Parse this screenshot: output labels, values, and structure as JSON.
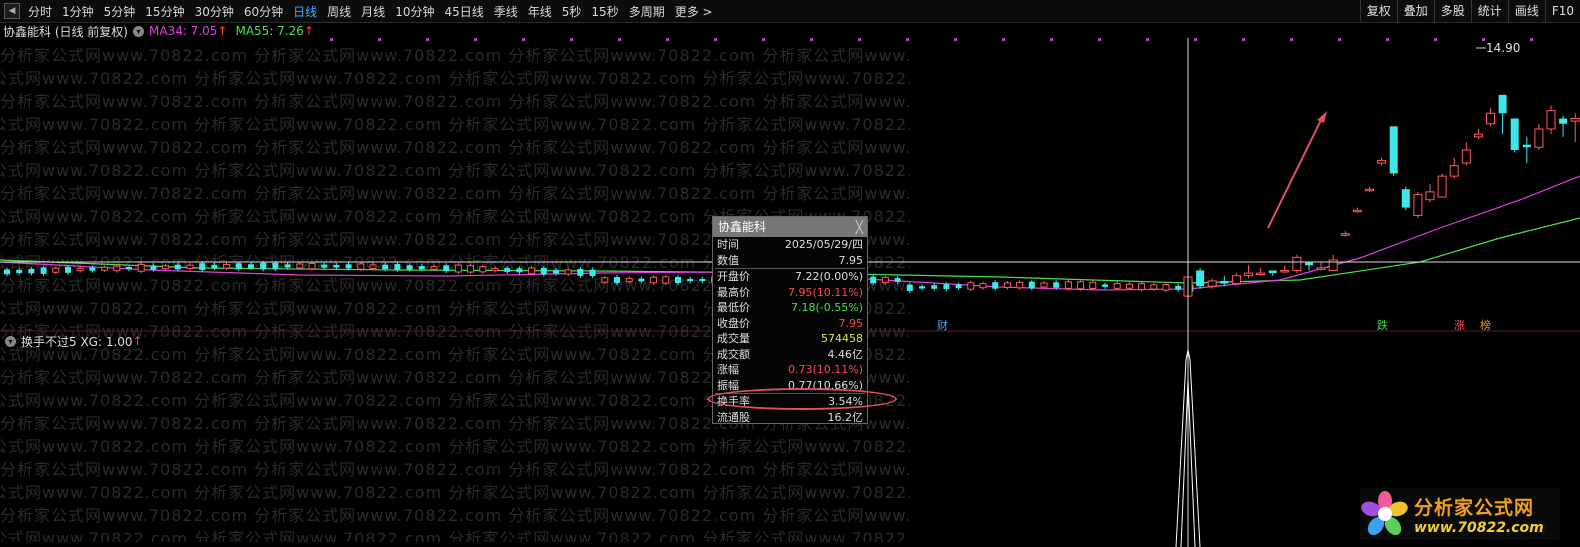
{
  "toolbar": {
    "periods": [
      "分时",
      "1分钟",
      "5分钟",
      "15分钟",
      "30分钟",
      "60分钟",
      "日线",
      "周线",
      "月线",
      "10分钟",
      "45日线",
      "季线",
      "年线",
      "5秒",
      "15秒",
      "多周期",
      "更多 >"
    ],
    "active_period": "日线",
    "right_buttons": [
      "复权",
      "叠加",
      "多股",
      "统计",
      "画线",
      "F10"
    ]
  },
  "header": {
    "stock_title": "协鑫能科 (日线 前复权)",
    "ma34_label": "MA34: 7.05",
    "ma55_label": "MA55: 7.26",
    "up_arrow": "↑"
  },
  "indicator": {
    "label": "换手不过5 XG: 1.00",
    "up_arrow": "↑"
  },
  "price_high_label": "14.90",
  "events": {
    "cai": "财",
    "die": "跌",
    "zhang": "涨",
    "bang": "榜"
  },
  "watermark": "分析家公式网www.70822.com",
  "tooltip": {
    "title": "协鑫能科",
    "close": "╳",
    "rows": [
      {
        "label": "时间",
        "value": "2025/05/29/四",
        "color": "normal"
      },
      {
        "label": "数值",
        "value": "7.95",
        "color": "normal"
      },
      {
        "label": "开盘价",
        "value": "7.22(0.00%)",
        "color": "normal"
      },
      {
        "label": "最高价",
        "value": "7.95(10.11%)",
        "color": "red"
      },
      {
        "label": "最低价",
        "value": "7.18(-0.55%)",
        "color": "green"
      },
      {
        "label": "收盘价",
        "value": "7.95",
        "color": "red"
      },
      {
        "label": "成交量",
        "value": "574458",
        "color": "yellow"
      },
      {
        "label": "成交额",
        "value": "4.46亿",
        "color": "normal"
      },
      {
        "label": "涨幅",
        "value": "0.73(10.11%)",
        "color": "red"
      },
      {
        "label": "振幅",
        "value": "0.77(10.66%)",
        "color": "normal"
      },
      {
        "label": "换手率",
        "value": "3.54%",
        "color": "normal"
      },
      {
        "label": "流通股",
        "value": "16.2亿",
        "color": "normal"
      }
    ]
  },
  "logo": {
    "name": "分析家公式网",
    "url": "www.70822.com"
  },
  "colors": {
    "up": "#ff5a5a",
    "down": "#3ee8e8",
    "ma34": "#e040e0",
    "ma55": "#4ce04c",
    "active_tab": "#4aa8ff"
  },
  "candles_right": [
    {
      "o": 7.22,
      "c": 7.95,
      "h": 7.95,
      "l": 7.18
    },
    {
      "o": 8.2,
      "c": 7.6,
      "h": 8.3,
      "l": 7.5
    },
    {
      "o": 7.6,
      "c": 7.8,
      "h": 7.9,
      "l": 7.5
    },
    {
      "o": 7.8,
      "c": 7.7,
      "h": 8.0,
      "l": 7.6
    },
    {
      "o": 7.7,
      "c": 8.0,
      "h": 8.1,
      "l": 7.7
    },
    {
      "o": 8.0,
      "c": 8.1,
      "h": 8.4,
      "l": 7.9
    },
    {
      "o": 8.1,
      "c": 8.1,
      "h": 8.3,
      "l": 8.0
    },
    {
      "o": 8.2,
      "c": 8.1,
      "h": 8.2,
      "l": 8.0
    },
    {
      "o": 8.2,
      "c": 8.2,
      "h": 8.4,
      "l": 8.1
    },
    {
      "o": 8.2,
      "c": 8.7,
      "h": 8.8,
      "l": 8.1
    },
    {
      "o": 8.5,
      "c": 8.4,
      "h": 8.5,
      "l": 8.2
    },
    {
      "o": 8.3,
      "c": 8.3,
      "h": 8.5,
      "l": 8.2
    },
    {
      "o": 8.2,
      "c": 8.6,
      "h": 8.8,
      "l": 8.2
    },
    {
      "o": 9.6,
      "c": 9.6,
      "h": 9.7,
      "l": 9.5
    },
    {
      "o": 10.5,
      "c": 10.5,
      "h": 10.6,
      "l": 10.4
    },
    {
      "o": 11.3,
      "c": 11.3,
      "h": 11.4,
      "l": 11.2
    },
    {
      "o": 12.3,
      "c": 12.4,
      "h": 12.5,
      "l": 12.2
    },
    {
      "o": 13.7,
      "c": 11.9,
      "h": 13.7,
      "l": 11.8
    },
    {
      "o": 11.3,
      "c": 10.6,
      "h": 11.4,
      "l": 10.5
    },
    {
      "o": 10.3,
      "c": 11.1,
      "h": 11.2,
      "l": 10.2
    },
    {
      "o": 10.9,
      "c": 11.2,
      "h": 11.5,
      "l": 10.8
    },
    {
      "o": 11.0,
      "c": 11.8,
      "h": 11.9,
      "l": 11.0
    },
    {
      "o": 11.8,
      "c": 12.2,
      "h": 12.5,
      "l": 11.7
    },
    {
      "o": 12.3,
      "c": 12.8,
      "h": 13.1,
      "l": 12.2
    },
    {
      "o": 13.3,
      "c": 13.4,
      "h": 13.6,
      "l": 13.2
    },
    {
      "o": 13.8,
      "c": 14.2,
      "h": 14.4,
      "l": 13.7
    },
    {
      "o": 14.9,
      "c": 14.2,
      "h": 14.9,
      "l": 13.4
    },
    {
      "o": 14.0,
      "c": 12.8,
      "h": 14.0,
      "l": 12.7
    },
    {
      "o": 13.0,
      "c": 12.9,
      "h": 13.3,
      "l": 12.3
    },
    {
      "o": 12.9,
      "c": 13.6,
      "h": 13.8,
      "l": 12.8
    },
    {
      "o": 13.6,
      "c": 14.3,
      "h": 14.5,
      "l": 13.4
    },
    {
      "o": 14.0,
      "c": 13.8,
      "h": 14.1,
      "l": 13.3
    },
    {
      "o": 13.9,
      "c": 14.0,
      "h": 14.2,
      "l": 13.1
    },
    {
      "o": 13.8,
      "c": 13.3,
      "h": 13.9,
      "l": 13.0
    }
  ]
}
